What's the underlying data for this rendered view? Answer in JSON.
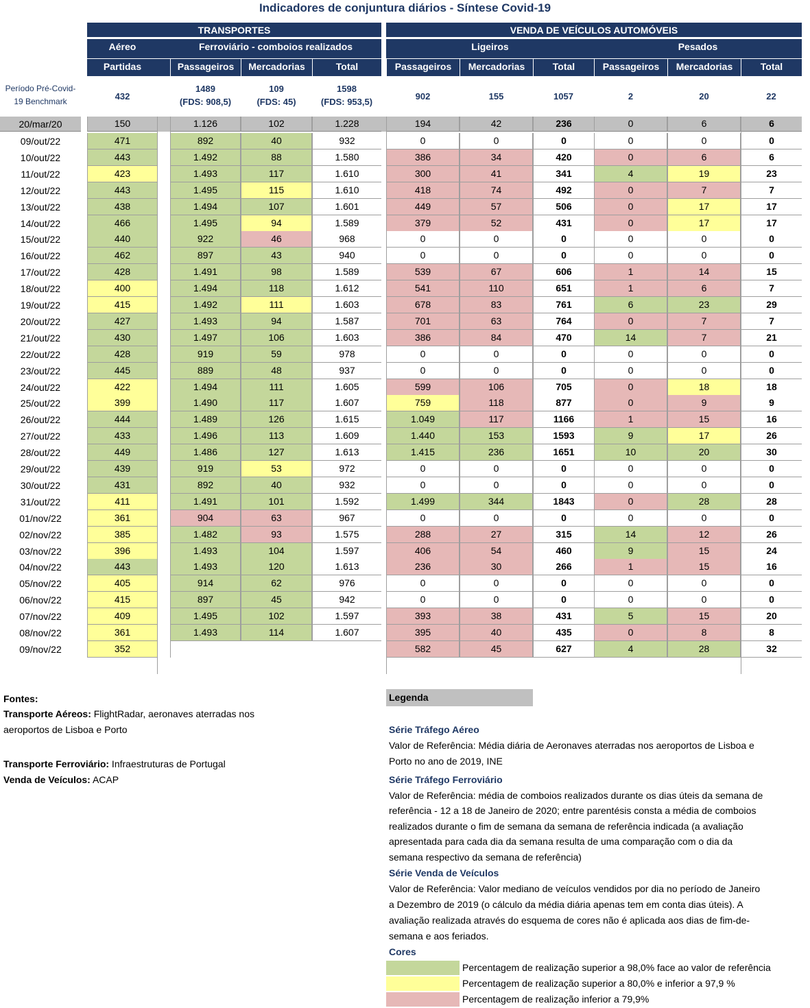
{
  "title": "Indicadores de conjuntura diários - Síntese Covid-19",
  "headers": {
    "transportes": "TRANSPORTES",
    "vendas": "VENDA DE VEÍCULOS AUTOMÓVEIS",
    "aereo": "Aéreo",
    "ferroviario": "Ferroviário - comboios realizados",
    "ligeiros": "Ligeiros",
    "pesados": "Pesados",
    "partidas": "Partidas",
    "passageiros": "Passageiros",
    "mercadorias": "Mercadorias",
    "total": "Total"
  },
  "benchmark": {
    "label_line1": "Período Pré-Covid-",
    "label_line2": "19 Benchmark",
    "aereo": "432",
    "fer_pass": "1489",
    "fer_pass_fds": "(FDS: 908,5)",
    "fer_merc": "109",
    "fer_merc_fds": "(FDS: 45)",
    "fer_total": "1598",
    "fer_total_fds": "(FDS: 953,5)",
    "lig_pass": "902",
    "lig_merc": "155",
    "lig_total": "1057",
    "pes_pass": "2",
    "pes_merc": "20",
    "pes_total": "22"
  },
  "rows": [
    {
      "d": "20/mar/20",
      "v": [
        "150",
        "1.126",
        "102",
        "1.228",
        "194",
        "42",
        "236",
        "0",
        "6",
        "6"
      ],
      "c": "AAAAAAAAAA"
    },
    {
      "d": "09/out/22",
      "v": [
        "471",
        "892",
        "40",
        "932",
        "0",
        "0",
        "0",
        "0",
        "0",
        "0"
      ],
      "c": "GGGWWWWWWW"
    },
    {
      "d": "10/out/22",
      "v": [
        "443",
        "1.492",
        "88",
        "1.580",
        "386",
        "34",
        "420",
        "0",
        "6",
        "6"
      ],
      "c": "GGGWRRWRRW"
    },
    {
      "d": "11/out/22",
      "v": [
        "423",
        "1.493",
        "117",
        "1.610",
        "300",
        "41",
        "341",
        "4",
        "19",
        "23"
      ],
      "c": "YGGWRRWGYW"
    },
    {
      "d": "12/out/22",
      "v": [
        "443",
        "1.495",
        "115",
        "1.610",
        "418",
        "74",
        "492",
        "0",
        "7",
        "7"
      ],
      "c": "GGYWRRWRRW"
    },
    {
      "d": "13/out/22",
      "v": [
        "438",
        "1.494",
        "107",
        "1.601",
        "449",
        "57",
        "506",
        "0",
        "17",
        "17"
      ],
      "c": "GGGWRRWRYW"
    },
    {
      "d": "14/out/22",
      "v": [
        "466",
        "1.495",
        "94",
        "1.589",
        "379",
        "52",
        "431",
        "0",
        "17",
        "17"
      ],
      "c": "GGYWRRWRYW"
    },
    {
      "d": "15/out/22",
      "v": [
        "440",
        "922",
        "46",
        "968",
        "0",
        "0",
        "0",
        "0",
        "0",
        "0"
      ],
      "c": "GGRWWWWWWW"
    },
    {
      "d": "16/out/22",
      "v": [
        "462",
        "897",
        "43",
        "940",
        "0",
        "0",
        "0",
        "0",
        "0",
        "0"
      ],
      "c": "GGGWWWWWWW"
    },
    {
      "d": "17/out/22",
      "v": [
        "428",
        "1.491",
        "98",
        "1.589",
        "539",
        "67",
        "606",
        "1",
        "14",
        "15"
      ],
      "c": "GGGWRRWRRW"
    },
    {
      "d": "18/out/22",
      "v": [
        "400",
        "1.494",
        "118",
        "1.612",
        "541",
        "110",
        "651",
        "1",
        "6",
        "7"
      ],
      "c": "YGGWRRWRRW"
    },
    {
      "d": "19/out/22",
      "v": [
        "415",
        "1.492",
        "111",
        "1.603",
        "678",
        "83",
        "761",
        "6",
        "23",
        "29"
      ],
      "c": "YGYWRRWGGW"
    },
    {
      "d": "20/out/22",
      "v": [
        "427",
        "1.493",
        "94",
        "1.587",
        "701",
        "63",
        "764",
        "0",
        "7",
        "7"
      ],
      "c": "GGGWRRWRRW"
    },
    {
      "d": "21/out/22",
      "v": [
        "430",
        "1.497",
        "106",
        "1.603",
        "386",
        "84",
        "470",
        "14",
        "7",
        "21"
      ],
      "c": "GGGWRRWGRW"
    },
    {
      "d": "22/out/22",
      "v": [
        "428",
        "919",
        "59",
        "978",
        "0",
        "0",
        "0",
        "0",
        "0",
        "0"
      ],
      "c": "GGGWWWWWWW"
    },
    {
      "d": "23/out/22",
      "v": [
        "445",
        "889",
        "48",
        "937",
        "0",
        "0",
        "0",
        "0",
        "0",
        "0"
      ],
      "c": "GGGWWWWWWW"
    },
    {
      "d": "24/out/22",
      "v": [
        "422",
        "1.494",
        "111",
        "1.605",
        "599",
        "106",
        "705",
        "0",
        "18",
        "18"
      ],
      "c": "YGGWRRWRYW"
    },
    {
      "d": "25/out/22",
      "v": [
        "399",
        "1.490",
        "117",
        "1.607",
        "759",
        "118",
        "877",
        "0",
        "9",
        "9"
      ],
      "c": "YGGWYRWRRW"
    },
    {
      "d": "26/out/22",
      "v": [
        "444",
        "1.489",
        "126",
        "1.615",
        "1.049",
        "117",
        "1166",
        "1",
        "15",
        "16"
      ],
      "c": "GGGWGRWRRW"
    },
    {
      "d": "27/out/22",
      "v": [
        "433",
        "1.496",
        "113",
        "1.609",
        "1.440",
        "153",
        "1593",
        "9",
        "17",
        "26"
      ],
      "c": "GGGWGGWGYW"
    },
    {
      "d": "28/out/22",
      "v": [
        "449",
        "1.486",
        "127",
        "1.613",
        "1.415",
        "236",
        "1651",
        "10",
        "20",
        "30"
      ],
      "c": "GGGWGGWGGW"
    },
    {
      "d": "29/out/22",
      "v": [
        "439",
        "919",
        "53",
        "972",
        "0",
        "0",
        "0",
        "0",
        "0",
        "0"
      ],
      "c": "GGYWWWWWWW"
    },
    {
      "d": "30/out/22",
      "v": [
        "431",
        "892",
        "40",
        "932",
        "0",
        "0",
        "0",
        "0",
        "0",
        "0"
      ],
      "c": "GGGWWWWWWW"
    },
    {
      "d": "31/out/22",
      "v": [
        "411",
        "1.491",
        "101",
        "1.592",
        "1.499",
        "344",
        "1843",
        "0",
        "28",
        "28"
      ],
      "c": "YGGWGGWRGW"
    },
    {
      "d": "01/nov/22",
      "v": [
        "361",
        "904",
        "63",
        "967",
        "0",
        "0",
        "0",
        "0",
        "0",
        "0"
      ],
      "c": "YRRWWWWWWW"
    },
    {
      "d": "02/nov/22",
      "v": [
        "385",
        "1.482",
        "93",
        "1.575",
        "288",
        "27",
        "315",
        "14",
        "12",
        "26"
      ],
      "c": "YGRWRRWGRW"
    },
    {
      "d": "03/nov/22",
      "v": [
        "396",
        "1.493",
        "104",
        "1.597",
        "406",
        "54",
        "460",
        "9",
        "15",
        "24"
      ],
      "c": "YGGWRRWGRW"
    },
    {
      "d": "04/nov/22",
      "v": [
        "443",
        "1.493",
        "120",
        "1.613",
        "236",
        "30",
        "266",
        "1",
        "15",
        "16"
      ],
      "c": "GGGWRRWRRW"
    },
    {
      "d": "05/nov/22",
      "v": [
        "405",
        "914",
        "62",
        "976",
        "0",
        "0",
        "0",
        "0",
        "0",
        "0"
      ],
      "c": "YGGWWWWWWW"
    },
    {
      "d": "06/nov/22",
      "v": [
        "415",
        "897",
        "45",
        "942",
        "0",
        "0",
        "0",
        "0",
        "0",
        "0"
      ],
      "c": "YGGWWWWWWW"
    },
    {
      "d": "07/nov/22",
      "v": [
        "409",
        "1.495",
        "102",
        "1.597",
        "393",
        "38",
        "431",
        "5",
        "15",
        "20"
      ],
      "c": "YGGWRRWGRW"
    },
    {
      "d": "08/nov/22",
      "v": [
        "361",
        "1.493",
        "114",
        "1.607",
        "395",
        "40",
        "435",
        "0",
        "8",
        "8"
      ],
      "c": "YGGWRRWRRW"
    },
    {
      "d": "09/nov/22",
      "v": [
        "352",
        "",
        "",
        "",
        "582",
        "45",
        "627",
        "4",
        "28",
        "32"
      ],
      "c": "YNNNRRWGGW"
    }
  ],
  "colors": {
    "G": "#c4d79b",
    "Y": "#ffff99",
    "R": "#e6b8b7",
    "W": "#ffffff",
    "A": "#c0c0c0",
    "header": "#1f3864"
  },
  "sources": {
    "heading": "Fontes:",
    "aereo_label": "Transporte Aéreos:",
    "aereo_text1": " FlightRadar, aeronaves aterradas nos",
    "aereo_text2": "aeroportos de Lisboa e Porto",
    "fer_label": "Transporte Ferroviário:",
    "fer_text": " Infraestruturas de Portugal",
    "venda_label": "Venda de Veículos:",
    "venda_text": " ACAP"
  },
  "legend": {
    "heading": "Legenda",
    "aereo_title": "Série Tráfego Aéreo",
    "aereo_l1": "Valor de Referência: Média diária de Aeronaves aterradas nos aeroportos de Lisboa e",
    "aereo_l2": "Porto no ano de 2019, INE",
    "fer_title": "Série Tráfego Ferroviário",
    "fer_l1": "Valor de Referência: média de comboios realizados durante os dias úteis da semana de",
    "fer_l2": "referência - 12 a 18 de Janeiro de 2020; entre parentésis consta a média de comboios",
    "fer_l3": "realizados durante o fim de semana da semana de referência indicada (a avaliação",
    "fer_l4": "apresentada para cada dia da semana resulta de uma comparação com o dia da",
    "fer_l5": "semana respectivo da semana de referência)",
    "venda_title": "Série Venda de Veículos",
    "venda_l1": "Valor de Referência: Valor mediano de veículos vendidos por dia no período de Janeiro",
    "venda_l2": "a Dezembro de 2019 (o cálculo da média diária apenas tem em conta dias úteis). A",
    "venda_l3": "avaliação realizada através do esquema de cores não é aplicada aos dias de fim-de-",
    "venda_l4": "semana e aos feriados.",
    "cores_title": "Cores",
    "cor_green": "Percentagem de realização superior a 98,0% face ao valor de referência",
    "cor_yellow": "Percentagem de realização superior a 80,0% e inferior a 97,9 %",
    "cor_red": "Percentagem de realização inferior a 79,9%"
  }
}
